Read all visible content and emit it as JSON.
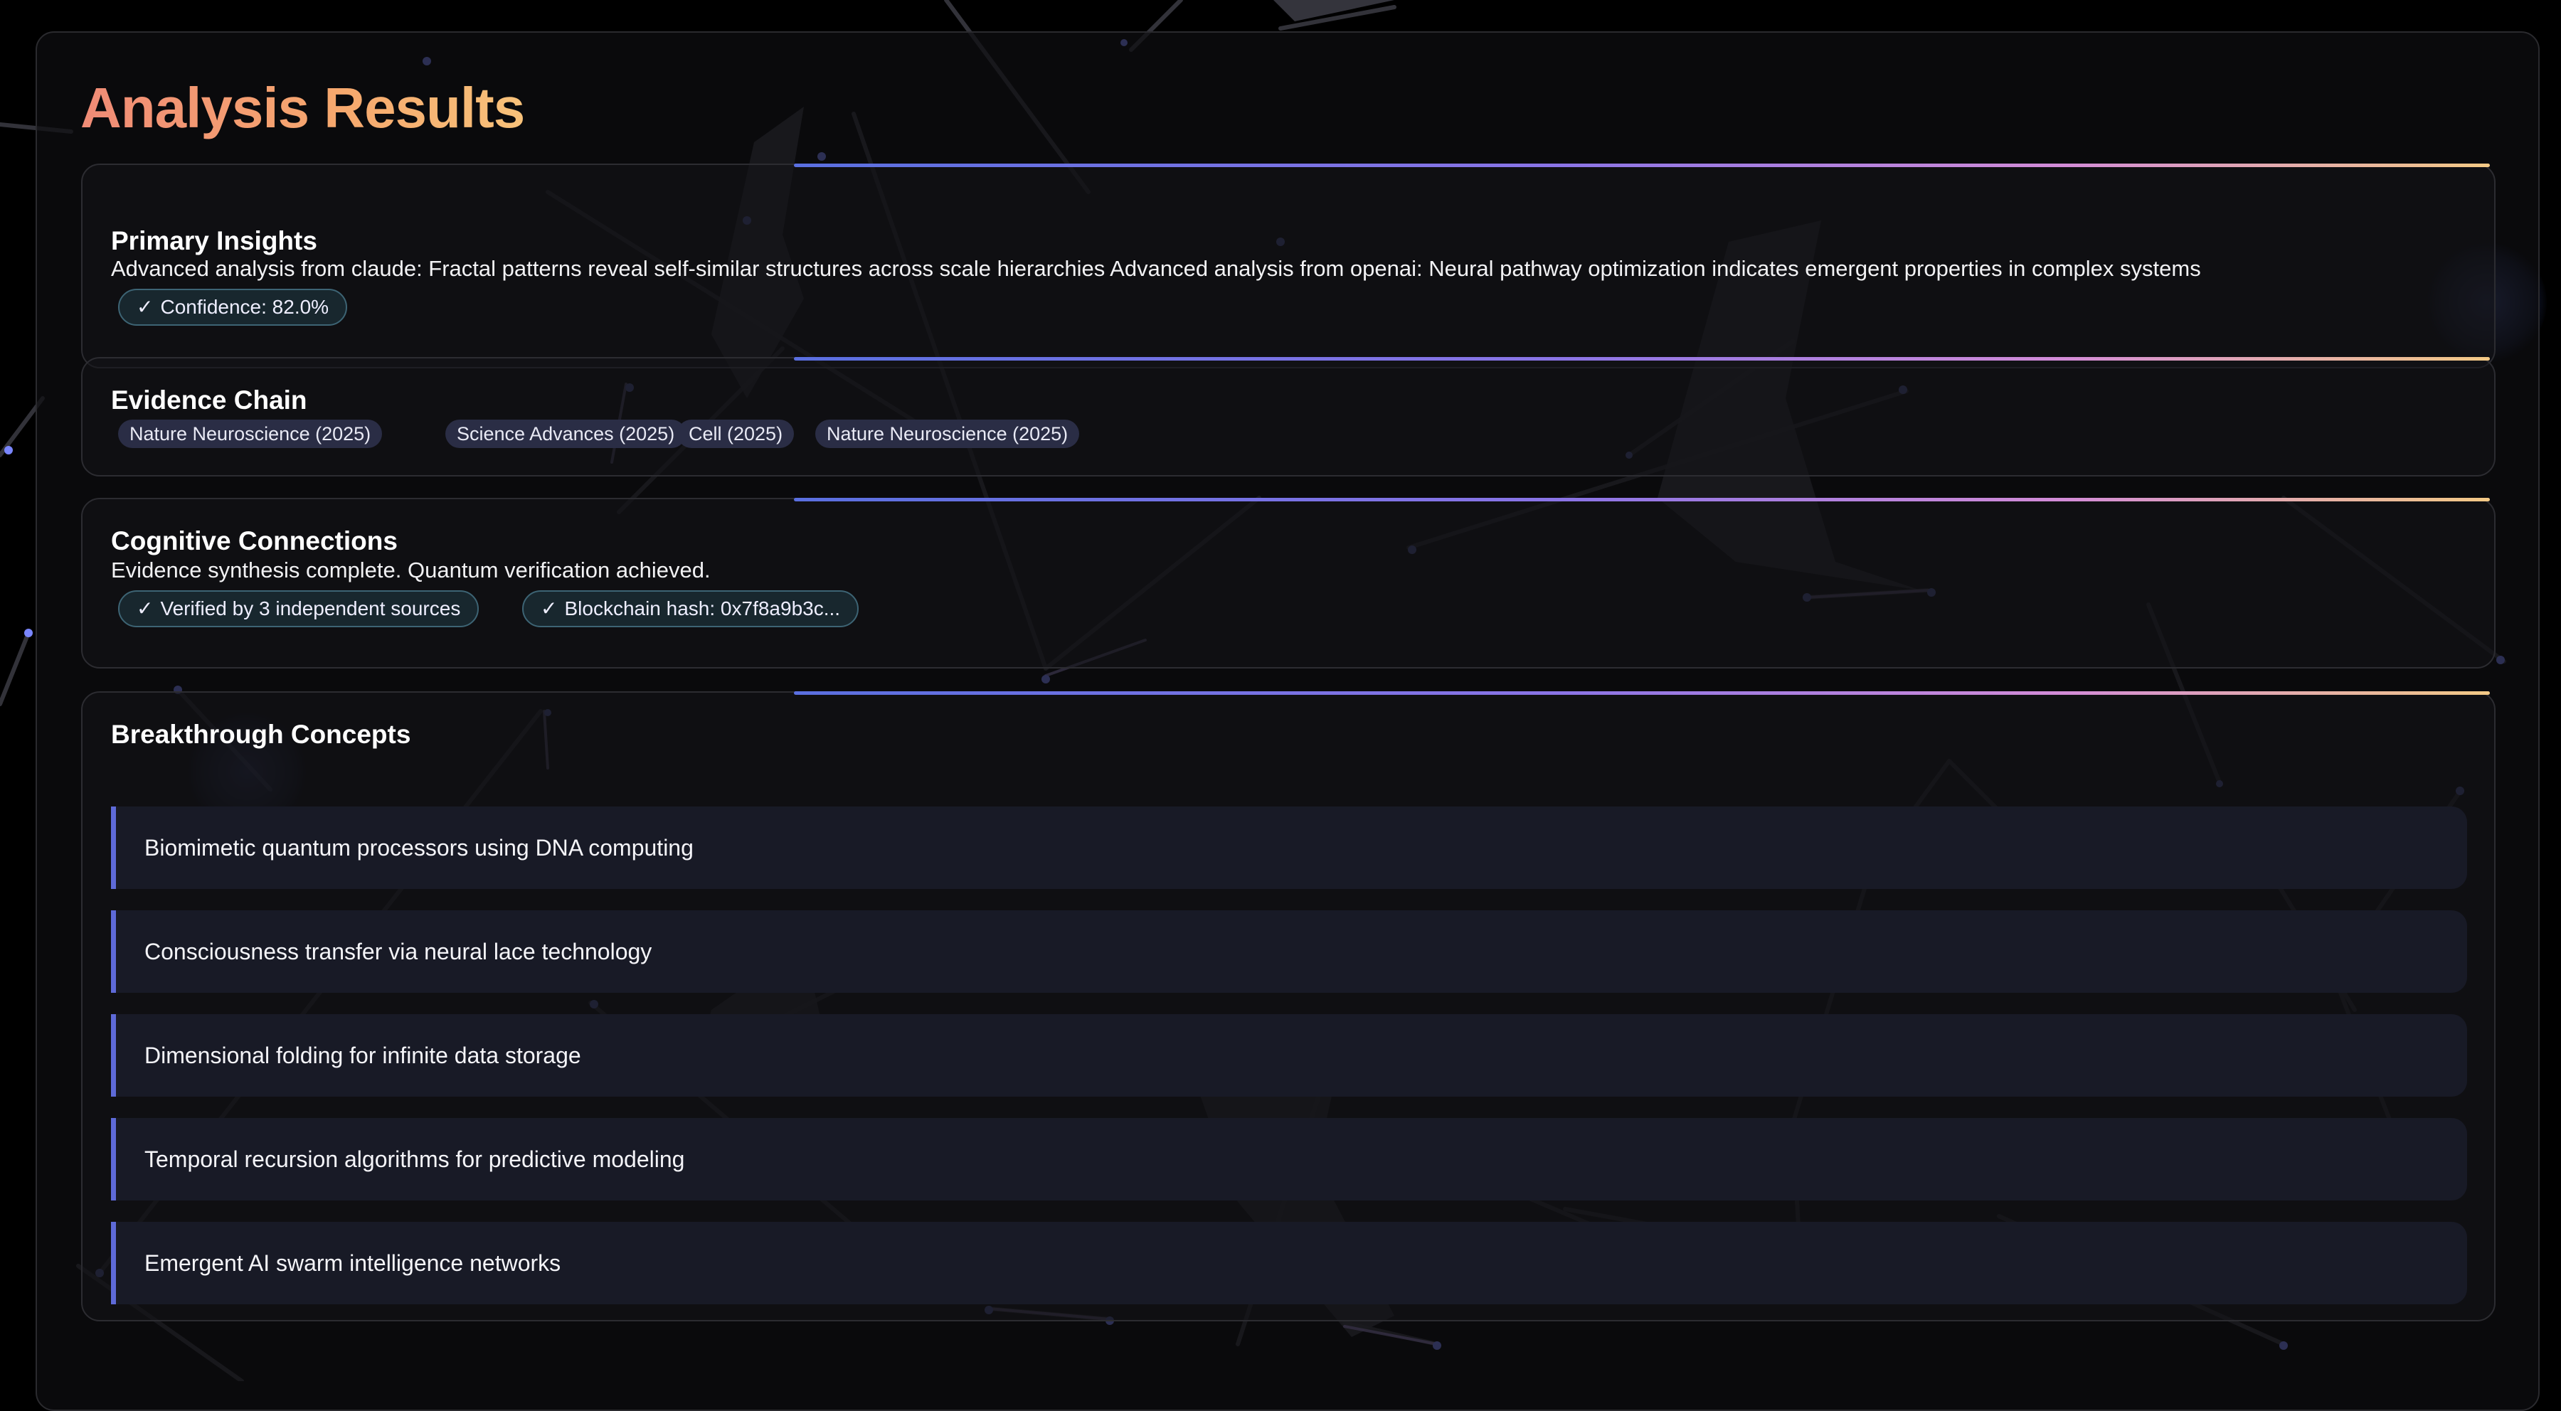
{
  "page_title": "Analysis Results",
  "primary_insights": {
    "title": "Primary Insights",
    "text": "Advanced analysis from claude: Fractal patterns reveal self-similar structures across scale hierarchies Advanced analysis from openai: Neural pathway optimization indicates emergent properties in complex systems",
    "confidence_label": "Confidence: 82.0%",
    "check_icon": "check-icon"
  },
  "evidence_chain": {
    "title": "Evidence Chain",
    "sources": [
      "Nature Neuroscience (2025)",
      "Science Advances (2025)",
      "Cell (2025)",
      "Nature Neuroscience (2025)"
    ]
  },
  "cognitive_connections": {
    "title": "Cognitive Connections",
    "text": "Evidence synthesis complete. Quantum verification achieved.",
    "badges": [
      "Verified by 3 independent sources",
      "Blockchain hash: 0x7f8a9b3c..."
    ]
  },
  "breakthrough_concepts": {
    "title": "Breakthrough Concepts",
    "items": [
      "Biomimetic quantum processors using DNA computing",
      "Consciousness transfer via neural lace technology",
      "Dimensional folding for infinite data storage",
      "Temporal recursion algorithms for predictive modeling",
      "Emergent AI swarm intelligence networks"
    ]
  },
  "colors": {
    "title_gradient_start": "#f08b76",
    "title_gradient_end": "#f8c27a",
    "accent": "#5e6ad8",
    "badge_border": "#3d6474",
    "background": "#000000"
  }
}
